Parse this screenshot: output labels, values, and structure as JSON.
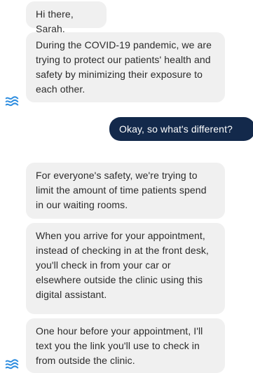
{
  "conversation": {
    "messages": [
      {
        "sender": "bot",
        "text": "Hi there, Sarah."
      },
      {
        "sender": "bot",
        "text": "During the COVID-19 pandemic, we are trying to protect our patients' health and safety by minimizing their exposure to each other."
      },
      {
        "sender": "user",
        "text": "Okay, so what's different?"
      },
      {
        "sender": "bot",
        "text": "For everyone's safety, we're trying to limit the amount of time patients spend in our waiting rooms."
      },
      {
        "sender": "bot",
        "text": "When you arrive for your appointment, instead of checking in at the front desk, you'll check in from your car or elsewhere outside the clinic using this digital assistant."
      },
      {
        "sender": "bot",
        "text": "One hour before your appointment, I'll text you the link you'll use to check in from outside the clinic."
      }
    ],
    "bot_avatar_icon": "wave-logo-icon",
    "colors": {
      "bot_bubble": "#f0f0f0",
      "user_bubble": "#13294b",
      "avatar": "#2f8ee0"
    }
  }
}
